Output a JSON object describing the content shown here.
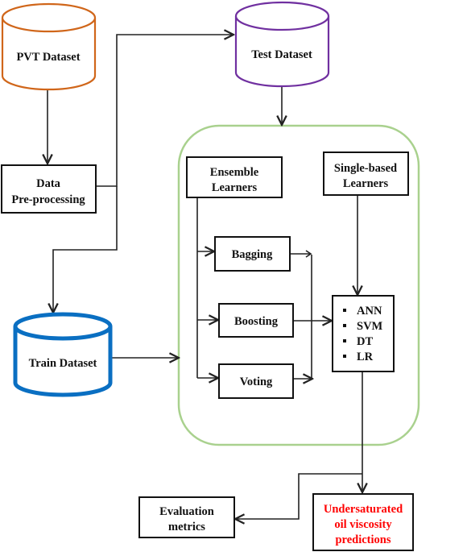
{
  "colors": {
    "pvt": "#d0661a",
    "test": "#7030a0",
    "train": "#0a6fc2",
    "container": "#a9d18e",
    "prediction_text": "#ff0000"
  },
  "nodes": {
    "pvt": "PVT Dataset",
    "test": "Test Dataset",
    "train": "Train Dataset",
    "preprocess": [
      "Data",
      "Pre-processing"
    ],
    "ensemble": [
      "Ensemble",
      "Learners"
    ],
    "single": [
      "Single-based",
      "Learners"
    ],
    "bagging": "Bagging",
    "boosting": "Boosting",
    "voting": "Voting",
    "models": [
      "ANN",
      "SVM",
      "DT",
      "LR"
    ],
    "evaluation": [
      "Evaluation",
      "metrics"
    ],
    "predictions": [
      "Undersaturated",
      "oil viscosity",
      "predictions"
    ]
  }
}
